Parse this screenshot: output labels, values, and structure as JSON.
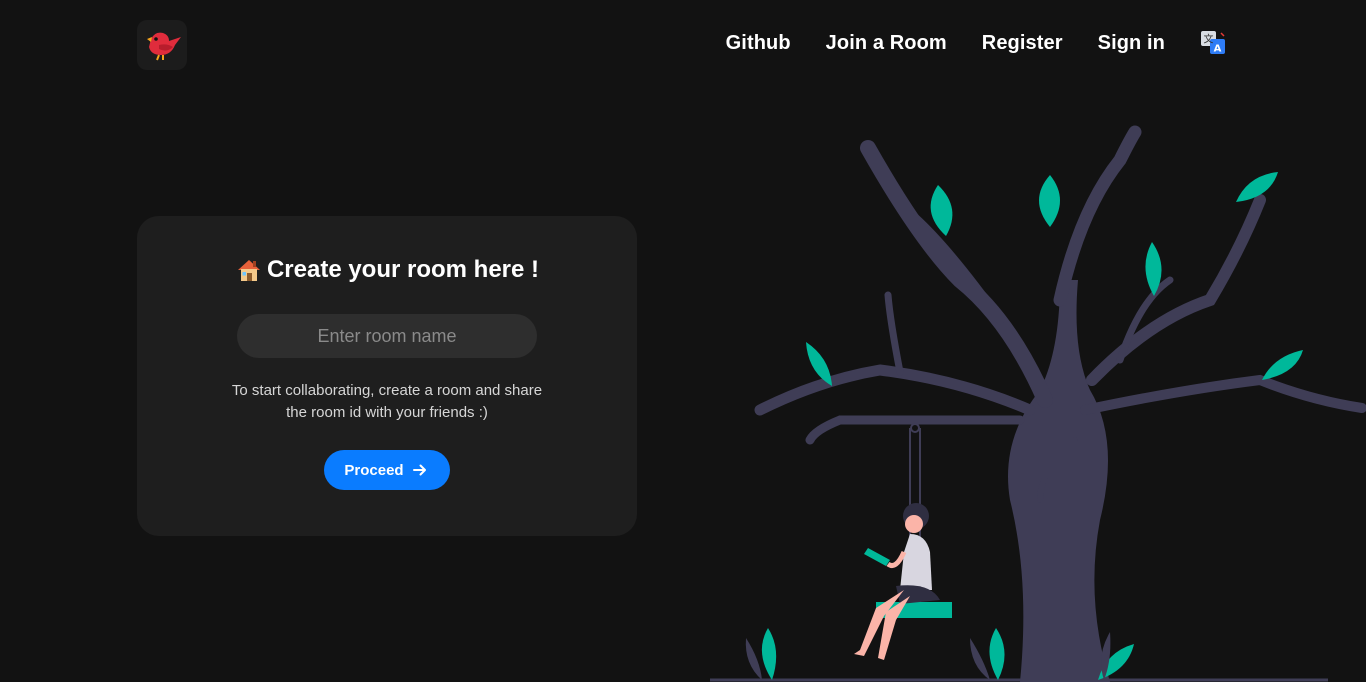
{
  "header": {
    "logo_icon": "red-bird-icon",
    "nav": [
      {
        "label": "Github"
      },
      {
        "label": "Join a Room"
      },
      {
        "label": "Register"
      },
      {
        "label": "Sign in"
      }
    ],
    "translate_icon": "translate-icon"
  },
  "card": {
    "title_icon": "house-icon",
    "title": "Create your room here !",
    "input": {
      "placeholder": "Enter room name",
      "value": ""
    },
    "help_text": "To start collaborating, create a room and share the room id with your friends :)",
    "button": {
      "label": "Proceed",
      "icon": "arrow-right-icon"
    }
  },
  "illustration": {
    "icon": "tree-swing-illustration"
  },
  "colors": {
    "background": "#121212",
    "card": "#1e1e1e",
    "input": "#2e2e2e",
    "accent": "#0a7cff",
    "leaf": "#00b89a",
    "trunk": "#3f3d56"
  }
}
